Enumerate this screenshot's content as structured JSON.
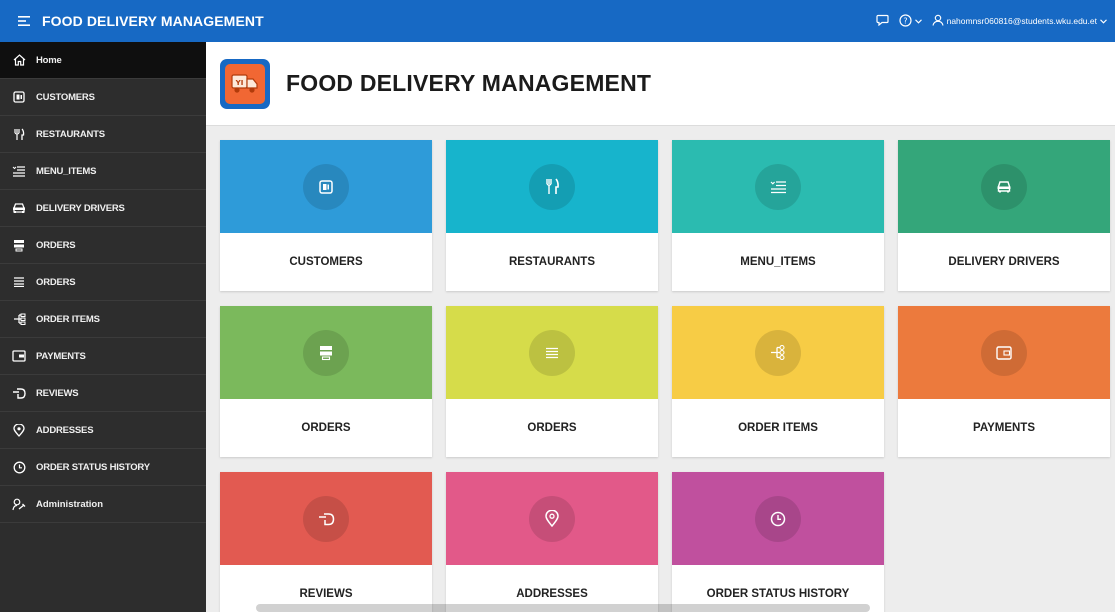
{
  "header": {
    "title": "FOOD DELIVERY MANAGEMENT",
    "user": "nahomnsr060816@students.wku.edu.et",
    "icons": [
      "menu-icon",
      "chat-icon",
      "help-icon",
      "user-icon"
    ]
  },
  "sidebar": {
    "items": [
      {
        "label": "Home",
        "icon": "home-icon",
        "active": true
      },
      {
        "label": "CUSTOMERS",
        "icon": "contact-card-icon"
      },
      {
        "label": "RESTAURANTS",
        "icon": "fork-knife-icon"
      },
      {
        "label": "MENU_ITEMS",
        "icon": "list-icon"
      },
      {
        "label": "DELIVERY DRIVERS",
        "icon": "car-icon"
      },
      {
        "label": "ORDERS",
        "icon": "server-icon"
      },
      {
        "label": "ORDERS",
        "icon": "lines-icon"
      },
      {
        "label": "ORDER ITEMS",
        "icon": "tree-icon"
      },
      {
        "label": "PAYMENTS",
        "icon": "wallet-icon"
      },
      {
        "label": "REVIEWS",
        "icon": "pointing-hand-icon"
      },
      {
        "label": "ADDRESSES",
        "icon": "map-pin-icon"
      },
      {
        "label": "ORDER STATUS HISTORY",
        "icon": "history-icon"
      },
      {
        "label": "Administration",
        "icon": "user-wrench-icon"
      }
    ]
  },
  "main": {
    "title": "FOOD DELIVERY MANAGEMENT",
    "cards": [
      {
        "label": "CUSTOMERS",
        "icon": "contact-card-icon",
        "color": "#2e9bd9"
      },
      {
        "label": "RESTAURANTS",
        "icon": "fork-knife-icon",
        "color": "#17b4cc"
      },
      {
        "label": "MENU_ITEMS",
        "icon": "list-icon",
        "color": "#2bbbb0"
      },
      {
        "label": "DELIVERY DRIVERS",
        "icon": "car-icon",
        "color": "#34a67a"
      },
      {
        "label": "ORDERS",
        "icon": "server-icon",
        "color": "#7bb95c"
      },
      {
        "label": "ORDERS",
        "icon": "lines-icon",
        "color": "#d6dc4a"
      },
      {
        "label": "ORDER ITEMS",
        "icon": "tree-icon",
        "color": "#f7cc45"
      },
      {
        "label": "PAYMENTS",
        "icon": "wallet-icon",
        "color": "#ec7a3d"
      },
      {
        "label": "REVIEWS",
        "icon": "pointing-hand-icon",
        "color": "#e25a51"
      },
      {
        "label": "ADDRESSES",
        "icon": "map-pin-icon",
        "color": "#e25989"
      },
      {
        "label": "ORDER STATUS HISTORY",
        "icon": "history-icon",
        "color": "#c0509e"
      }
    ]
  },
  "colors": {
    "header_bg": "#1769c4",
    "sidebar_bg": "#2d2d2d",
    "active_bg": "#0f0f0f"
  }
}
